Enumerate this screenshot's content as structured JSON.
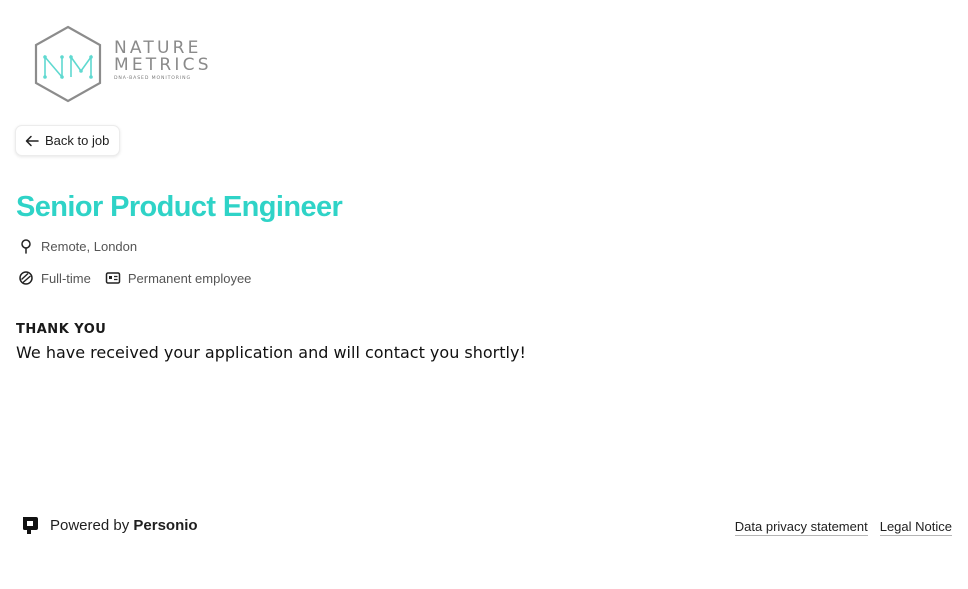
{
  "brand": {
    "logo_monogram": "NM",
    "logo_word_1": "NATURE",
    "logo_word_2": "METRICS",
    "logo_tagline": "DNA-BASED MONITORING"
  },
  "nav": {
    "back_label": "Back to job",
    "back_icon": "arrow-left-icon"
  },
  "job": {
    "title": "Senior Product Engineer",
    "location": "Remote, London",
    "schedule": "Full-time",
    "employment_type": "Permanent employee"
  },
  "confirmation": {
    "heading": "THANK YOU",
    "message": "We have received your application and will contact you shortly!"
  },
  "footer": {
    "powered_prefix": "Powered by",
    "powered_brand": "Personio",
    "links": [
      "Data privacy statement",
      "Legal Notice"
    ]
  },
  "colors": {
    "accent": "#2fd3c7",
    "logo_grey": "#8a8a8a",
    "text": "#1a1a1a",
    "muted": "#555555"
  }
}
